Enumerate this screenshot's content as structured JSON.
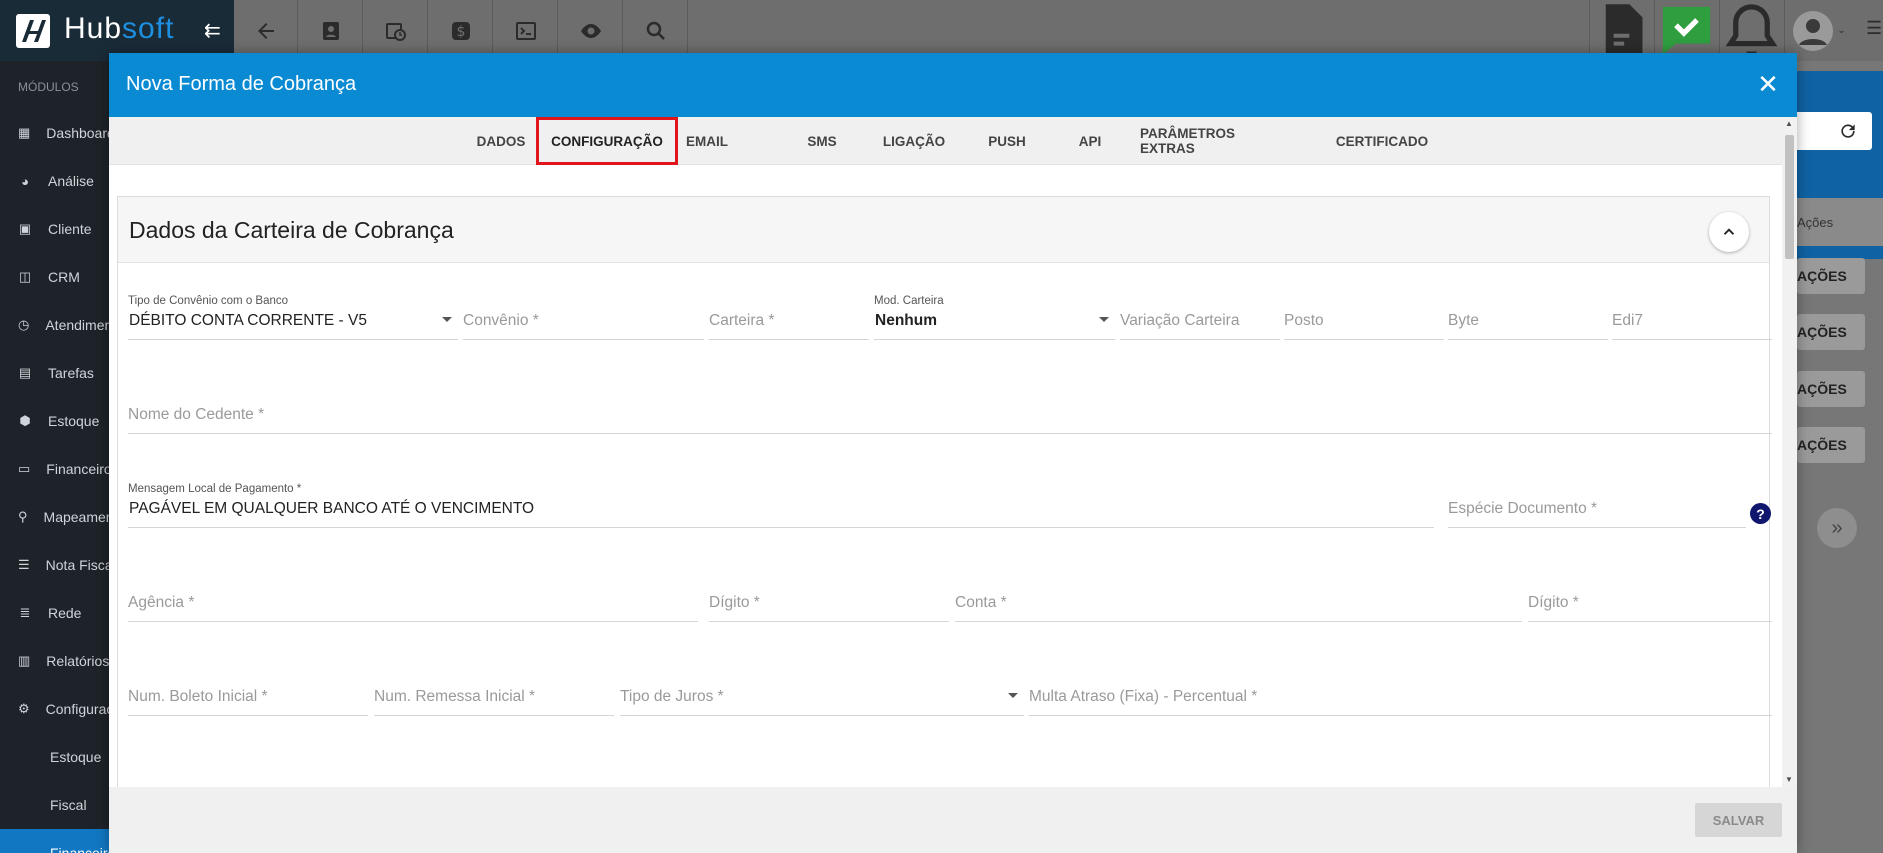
{
  "app": {
    "logo_text_a": "Hub",
    "logo_text_b": "soft"
  },
  "sidebar": {
    "section_label": "MÓDULOS",
    "items": [
      {
        "label": "Dashboard",
        "icon": "dashboard-icon"
      },
      {
        "label": "Análise",
        "icon": "pie-chart-icon"
      },
      {
        "label": "Cliente",
        "icon": "contact-card-icon"
      },
      {
        "label": "CRM",
        "icon": "board-icon"
      },
      {
        "label": "Atendimento",
        "icon": "calendar-clock-icon"
      },
      {
        "label": "Tarefas",
        "icon": "clipboard-icon"
      },
      {
        "label": "Estoque",
        "icon": "box-icon"
      },
      {
        "label": "Financeiro",
        "icon": "money-icon"
      },
      {
        "label": "Mapeamento",
        "icon": "map-pin-icon"
      },
      {
        "label": "Nota Fiscal",
        "icon": "list-icon"
      },
      {
        "label": "Rede",
        "icon": "server-icon"
      },
      {
        "label": "Relatórios",
        "icon": "document-icon"
      },
      {
        "label": "Configurações",
        "icon": "gear-icon"
      }
    ],
    "sub_items": [
      {
        "label": "Estoque"
      },
      {
        "label": "Fiscal"
      },
      {
        "label": "Financeiro"
      }
    ]
  },
  "background": {
    "col_header": "Ações",
    "action_label": "AÇÕES"
  },
  "modal": {
    "title": "Nova Forma de Cobrança",
    "tabs": [
      "DADOS",
      "CONFIGURAÇÃO",
      "EMAIL",
      "SMS",
      "LIGAÇÃO",
      "PUSH",
      "API",
      "PARÂMETROS EXTRAS",
      "CERTIFICADO"
    ],
    "active_tab": "CONFIGURAÇÃO",
    "card_title": "Dados da Carteira de Cobrança",
    "fields": {
      "tipo_convenio_label": "Tipo de Convênio com o Banco",
      "tipo_convenio_value": "DÉBITO CONTA CORRENTE - V5",
      "convenio": "Convênio *",
      "carteira": "Carteira *",
      "mod_carteira_label": "Mod. Carteira",
      "mod_carteira_value": "Nenhum",
      "variacao_carteira": "Variação Carteira",
      "posto": "Posto",
      "byte": "Byte",
      "edi7": "Edi7",
      "nome_cedente": "Nome do Cedente *",
      "mensagem_label": "Mensagem Local de Pagamento *",
      "mensagem_value": "PAGÁVEL EM QUALQUER BANCO ATÉ O VENCIMENTO",
      "especie_documento": "Espécie Documento *",
      "agencia": "Agência *",
      "digito_agencia": "Dígito *",
      "conta": "Conta *",
      "digito_conta": "Dígito *",
      "num_boleto": "Num. Boleto Inicial *",
      "num_remessa": "Num. Remessa Inicial *",
      "tipo_juros": "Tipo de Juros *",
      "multa_atraso": "Multa Atraso (Fixa) - Percentual *"
    },
    "save_label": "SALVAR"
  }
}
